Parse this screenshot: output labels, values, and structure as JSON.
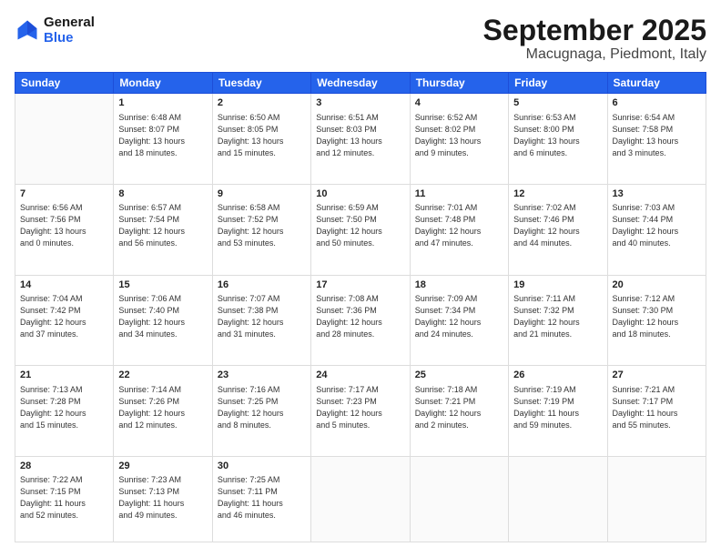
{
  "header": {
    "logo_line1": "General",
    "logo_line2": "Blue",
    "title": "September 2025",
    "subtitle": "Macugnaga, Piedmont, Italy"
  },
  "days": [
    "Sunday",
    "Monday",
    "Tuesday",
    "Wednesday",
    "Thursday",
    "Friday",
    "Saturday"
  ],
  "weeks": [
    [
      {
        "num": "",
        "lines": []
      },
      {
        "num": "1",
        "lines": [
          "Sunrise: 6:48 AM",
          "Sunset: 8:07 PM",
          "Daylight: 13 hours",
          "and 18 minutes."
        ]
      },
      {
        "num": "2",
        "lines": [
          "Sunrise: 6:50 AM",
          "Sunset: 8:05 PM",
          "Daylight: 13 hours",
          "and 15 minutes."
        ]
      },
      {
        "num": "3",
        "lines": [
          "Sunrise: 6:51 AM",
          "Sunset: 8:03 PM",
          "Daylight: 13 hours",
          "and 12 minutes."
        ]
      },
      {
        "num": "4",
        "lines": [
          "Sunrise: 6:52 AM",
          "Sunset: 8:02 PM",
          "Daylight: 13 hours",
          "and 9 minutes."
        ]
      },
      {
        "num": "5",
        "lines": [
          "Sunrise: 6:53 AM",
          "Sunset: 8:00 PM",
          "Daylight: 13 hours",
          "and 6 minutes."
        ]
      },
      {
        "num": "6",
        "lines": [
          "Sunrise: 6:54 AM",
          "Sunset: 7:58 PM",
          "Daylight: 13 hours",
          "and 3 minutes."
        ]
      }
    ],
    [
      {
        "num": "7",
        "lines": [
          "Sunrise: 6:56 AM",
          "Sunset: 7:56 PM",
          "Daylight: 13 hours",
          "and 0 minutes."
        ]
      },
      {
        "num": "8",
        "lines": [
          "Sunrise: 6:57 AM",
          "Sunset: 7:54 PM",
          "Daylight: 12 hours",
          "and 56 minutes."
        ]
      },
      {
        "num": "9",
        "lines": [
          "Sunrise: 6:58 AM",
          "Sunset: 7:52 PM",
          "Daylight: 12 hours",
          "and 53 minutes."
        ]
      },
      {
        "num": "10",
        "lines": [
          "Sunrise: 6:59 AM",
          "Sunset: 7:50 PM",
          "Daylight: 12 hours",
          "and 50 minutes."
        ]
      },
      {
        "num": "11",
        "lines": [
          "Sunrise: 7:01 AM",
          "Sunset: 7:48 PM",
          "Daylight: 12 hours",
          "and 47 minutes."
        ]
      },
      {
        "num": "12",
        "lines": [
          "Sunrise: 7:02 AM",
          "Sunset: 7:46 PM",
          "Daylight: 12 hours",
          "and 44 minutes."
        ]
      },
      {
        "num": "13",
        "lines": [
          "Sunrise: 7:03 AM",
          "Sunset: 7:44 PM",
          "Daylight: 12 hours",
          "and 40 minutes."
        ]
      }
    ],
    [
      {
        "num": "14",
        "lines": [
          "Sunrise: 7:04 AM",
          "Sunset: 7:42 PM",
          "Daylight: 12 hours",
          "and 37 minutes."
        ]
      },
      {
        "num": "15",
        "lines": [
          "Sunrise: 7:06 AM",
          "Sunset: 7:40 PM",
          "Daylight: 12 hours",
          "and 34 minutes."
        ]
      },
      {
        "num": "16",
        "lines": [
          "Sunrise: 7:07 AM",
          "Sunset: 7:38 PM",
          "Daylight: 12 hours",
          "and 31 minutes."
        ]
      },
      {
        "num": "17",
        "lines": [
          "Sunrise: 7:08 AM",
          "Sunset: 7:36 PM",
          "Daylight: 12 hours",
          "and 28 minutes."
        ]
      },
      {
        "num": "18",
        "lines": [
          "Sunrise: 7:09 AM",
          "Sunset: 7:34 PM",
          "Daylight: 12 hours",
          "and 24 minutes."
        ]
      },
      {
        "num": "19",
        "lines": [
          "Sunrise: 7:11 AM",
          "Sunset: 7:32 PM",
          "Daylight: 12 hours",
          "and 21 minutes."
        ]
      },
      {
        "num": "20",
        "lines": [
          "Sunrise: 7:12 AM",
          "Sunset: 7:30 PM",
          "Daylight: 12 hours",
          "and 18 minutes."
        ]
      }
    ],
    [
      {
        "num": "21",
        "lines": [
          "Sunrise: 7:13 AM",
          "Sunset: 7:28 PM",
          "Daylight: 12 hours",
          "and 15 minutes."
        ]
      },
      {
        "num": "22",
        "lines": [
          "Sunrise: 7:14 AM",
          "Sunset: 7:26 PM",
          "Daylight: 12 hours",
          "and 12 minutes."
        ]
      },
      {
        "num": "23",
        "lines": [
          "Sunrise: 7:16 AM",
          "Sunset: 7:25 PM",
          "Daylight: 12 hours",
          "and 8 minutes."
        ]
      },
      {
        "num": "24",
        "lines": [
          "Sunrise: 7:17 AM",
          "Sunset: 7:23 PM",
          "Daylight: 12 hours",
          "and 5 minutes."
        ]
      },
      {
        "num": "25",
        "lines": [
          "Sunrise: 7:18 AM",
          "Sunset: 7:21 PM",
          "Daylight: 12 hours",
          "and 2 minutes."
        ]
      },
      {
        "num": "26",
        "lines": [
          "Sunrise: 7:19 AM",
          "Sunset: 7:19 PM",
          "Daylight: 11 hours",
          "and 59 minutes."
        ]
      },
      {
        "num": "27",
        "lines": [
          "Sunrise: 7:21 AM",
          "Sunset: 7:17 PM",
          "Daylight: 11 hours",
          "and 55 minutes."
        ]
      }
    ],
    [
      {
        "num": "28",
        "lines": [
          "Sunrise: 7:22 AM",
          "Sunset: 7:15 PM",
          "Daylight: 11 hours",
          "and 52 minutes."
        ]
      },
      {
        "num": "29",
        "lines": [
          "Sunrise: 7:23 AM",
          "Sunset: 7:13 PM",
          "Daylight: 11 hours",
          "and 49 minutes."
        ]
      },
      {
        "num": "30",
        "lines": [
          "Sunrise: 7:25 AM",
          "Sunset: 7:11 PM",
          "Daylight: 11 hours",
          "and 46 minutes."
        ]
      },
      {
        "num": "",
        "lines": []
      },
      {
        "num": "",
        "lines": []
      },
      {
        "num": "",
        "lines": []
      },
      {
        "num": "",
        "lines": []
      }
    ]
  ]
}
